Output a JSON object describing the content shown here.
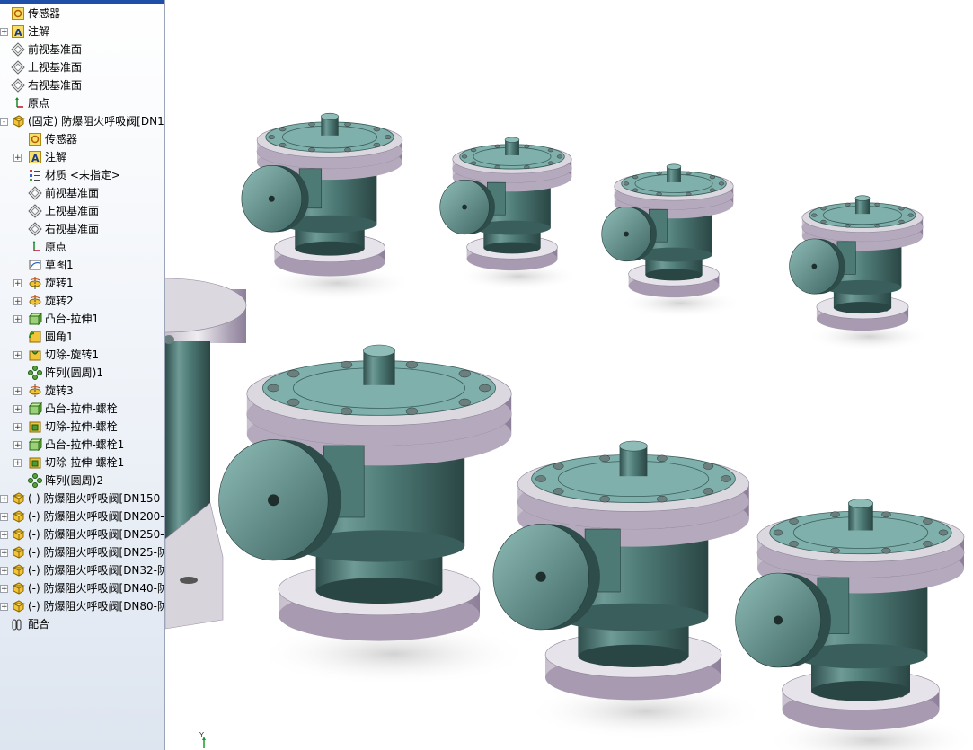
{
  "feature_tree": {
    "items": [
      {
        "label": "传感器",
        "icon": "sensor-icon",
        "indent": 0,
        "expander": "none"
      },
      {
        "label": "注解",
        "icon": "annotation-icon",
        "indent": 0,
        "expander": "+"
      },
      {
        "label": "前视基准面",
        "icon": "plane-icon",
        "indent": 0,
        "expander": "none"
      },
      {
        "label": "上视基准面",
        "icon": "plane-icon",
        "indent": 0,
        "expander": "none"
      },
      {
        "label": "右视基准面",
        "icon": "plane-icon",
        "indent": 0,
        "expander": "none"
      },
      {
        "label": "原点",
        "icon": "origin-icon",
        "indent": 0,
        "expander": "none"
      },
      {
        "label": "(固定) 防爆阻火呼吸阀[DN1",
        "icon": "part-icon",
        "indent": 0,
        "expander": "-"
      },
      {
        "label": "传感器",
        "icon": "sensor-icon",
        "indent": 1,
        "expander": "none"
      },
      {
        "label": "注解",
        "icon": "annotation-icon",
        "indent": 1,
        "expander": "+"
      },
      {
        "label": "材质 <未指定>",
        "icon": "material-icon",
        "indent": 1,
        "expander": "none"
      },
      {
        "label": "前视基准面",
        "icon": "plane-icon",
        "indent": 1,
        "expander": "none"
      },
      {
        "label": "上视基准面",
        "icon": "plane-icon",
        "indent": 1,
        "expander": "none"
      },
      {
        "label": "右视基准面",
        "icon": "plane-icon",
        "indent": 1,
        "expander": "none"
      },
      {
        "label": "原点",
        "icon": "origin-icon",
        "indent": 1,
        "expander": "none"
      },
      {
        "label": "草图1",
        "icon": "sketch-icon",
        "indent": 1,
        "expander": "none"
      },
      {
        "label": "旋转1",
        "icon": "revolve-icon",
        "indent": 1,
        "expander": "+"
      },
      {
        "label": "旋转2",
        "icon": "revolve-icon",
        "indent": 1,
        "expander": "+"
      },
      {
        "label": "凸台-拉伸1",
        "icon": "extrude-boss-icon",
        "indent": 1,
        "expander": "+"
      },
      {
        "label": "圆角1",
        "icon": "fillet-icon",
        "indent": 1,
        "expander": "none"
      },
      {
        "label": "切除-旋转1",
        "icon": "cut-revolve-icon",
        "indent": 1,
        "expander": "+"
      },
      {
        "label": "阵列(圆周)1",
        "icon": "circular-pattern-icon",
        "indent": 1,
        "expander": "none"
      },
      {
        "label": "旋转3",
        "icon": "revolve-icon",
        "indent": 1,
        "expander": "+"
      },
      {
        "label": "凸台-拉伸-螺栓",
        "icon": "extrude-boss-icon",
        "indent": 1,
        "expander": "+"
      },
      {
        "label": "切除-拉伸-螺栓",
        "icon": "cut-extrude-icon",
        "indent": 1,
        "expander": "+"
      },
      {
        "label": "凸台-拉伸-螺栓1",
        "icon": "extrude-boss-icon",
        "indent": 1,
        "expander": "+"
      },
      {
        "label": "切除-拉伸-螺栓1",
        "icon": "cut-extrude-icon",
        "indent": 1,
        "expander": "+"
      },
      {
        "label": "阵列(圆周)2",
        "icon": "circular-pattern-icon",
        "indent": 1,
        "expander": "none"
      },
      {
        "label": "(-) 防爆阻火呼吸阀[DN150-",
        "icon": "part-icon",
        "indent": 0,
        "expander": "+"
      },
      {
        "label": "(-) 防爆阻火呼吸阀[DN200-",
        "icon": "part-icon",
        "indent": 0,
        "expander": "+"
      },
      {
        "label": "(-) 防爆阻火呼吸阀[DN250-",
        "icon": "part-icon",
        "indent": 0,
        "expander": "+"
      },
      {
        "label": "(-) 防爆阻火呼吸阀[DN25-防",
        "icon": "part-icon",
        "indent": 0,
        "expander": "+"
      },
      {
        "label": "(-) 防爆阻火呼吸阀[DN32-防",
        "icon": "part-icon",
        "indent": 0,
        "expander": "+"
      },
      {
        "label": "(-) 防爆阻火呼吸阀[DN40-防",
        "icon": "part-icon",
        "indent": 0,
        "expander": "+"
      },
      {
        "label": "(-) 防爆阻火呼吸阀[DN80-防",
        "icon": "part-icon",
        "indent": 0,
        "expander": "+"
      },
      {
        "label": "配合",
        "icon": "mates-icon",
        "indent": 0,
        "expander": "none"
      }
    ]
  },
  "viewport": {
    "triad_axis_label": "Y",
    "colors": {
      "body": "#5f8a86",
      "body_dark": "#2e4f4d",
      "flange": "#d8d4dc",
      "flange_dark": "#9c8fa6",
      "cap": "#7fb0ab",
      "background": "#ffffff"
    }
  }
}
